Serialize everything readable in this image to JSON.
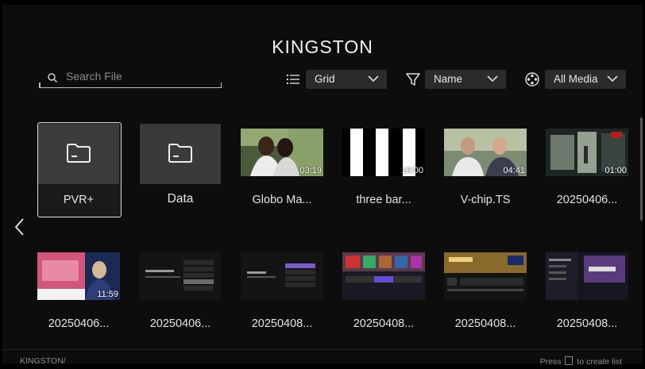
{
  "header": {
    "title": "KINGSTON"
  },
  "search": {
    "placeholder": "Search File"
  },
  "controls": {
    "view": {
      "value": "Grid"
    },
    "sort": {
      "value": "Name"
    },
    "media": {
      "value": "All Media"
    }
  },
  "row1": [
    {
      "label": "PVR+",
      "type": "folder"
    },
    {
      "label": "Data",
      "type": "folder"
    },
    {
      "label": "Globo Ma...",
      "duration": "03:19"
    },
    {
      "label": "three bar...",
      "duration": "10:00"
    },
    {
      "label": "V-chip.TS",
      "duration": "04:41"
    },
    {
      "label": "20250406...",
      "duration": "01:00"
    }
  ],
  "row2": [
    {
      "label": "20250406...",
      "duration": "11:59"
    },
    {
      "label": "20250406..."
    },
    {
      "label": "20250408..."
    },
    {
      "label": "20250408..."
    },
    {
      "label": "20250408..."
    },
    {
      "label": "20250408..."
    }
  ],
  "footer": {
    "path": "KINGSTON/",
    "hint_prefix": "Press",
    "hint_suffix": "to create list"
  }
}
